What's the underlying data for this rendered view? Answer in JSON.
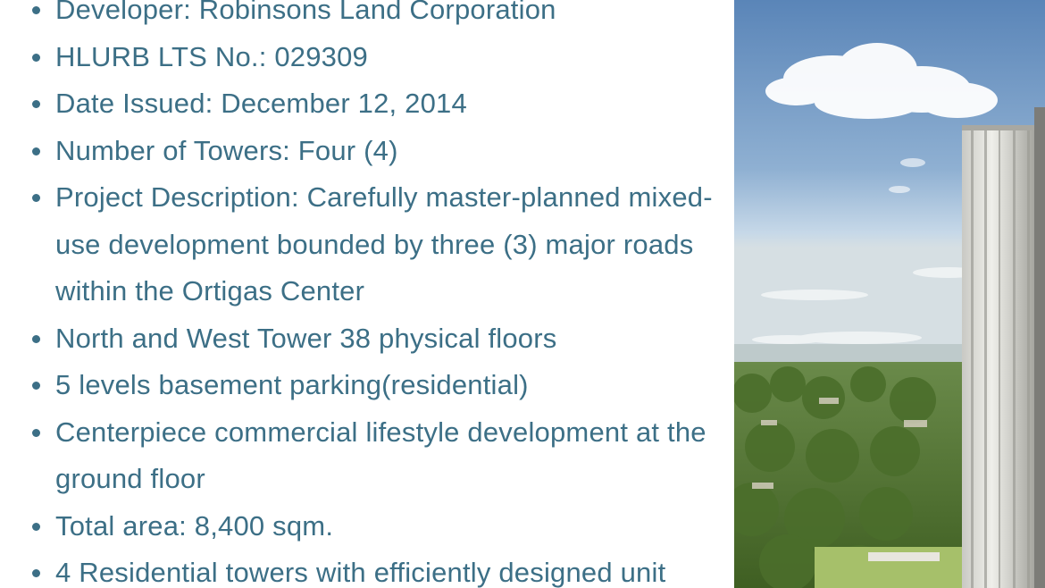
{
  "slide": {
    "bullets": [
      {
        "text": "Developer: Robinsons Land Corporation"
      },
      {
        "text": "HLURB LTS No.: 029309"
      },
      {
        "text": "Date Issued: December 12, 2014"
      },
      {
        "text": "Number of Towers: Four (4)"
      },
      {
        "text": "Project Description: Carefully master-planned mixed-use development bounded by three (3) major roads within the Ortigas Center"
      },
      {
        "text": "North and West Tower 38 physical floors"
      },
      {
        "text": "5 levels basement parking(residential)"
      },
      {
        "text": "Centerpiece commercial lifestyle development at the ground floor"
      },
      {
        "text": "Total area: 8,400 sqm."
      },
      {
        "text": "4 Residential towers with efficiently designed unit"
      }
    ]
  },
  "colors": {
    "text": "#3c6f86",
    "sky_top": "#5d86b8",
    "sky_bottom": "#c9dceb",
    "foliage": "#4a6b2a",
    "tower": "#d8d8d4"
  }
}
